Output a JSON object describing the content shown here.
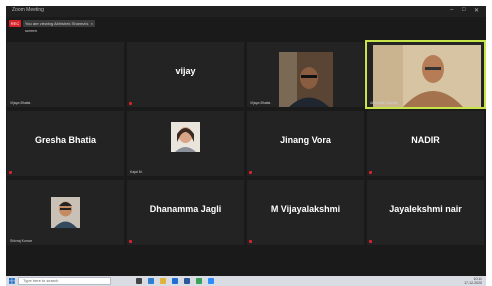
{
  "window": {
    "title": "Zoom Meeting",
    "controls": [
      "–",
      "□",
      "✕"
    ]
  },
  "toolbar": {
    "rec_label": "REC",
    "tab_label": "You are viewing Abhishek Sharma's screen"
  },
  "participants": [
    {
      "name": "",
      "caption": "Vijaya Bhatia"
    },
    {
      "name": "vijay",
      "caption": ""
    },
    {
      "name": "",
      "caption": "Vijaya Bhatia"
    },
    {
      "name": "",
      "caption": "Abhishek Sharma"
    },
    {
      "name": "Gresha Bhatia",
      "caption": ""
    },
    {
      "name": "",
      "caption": "Kajal M."
    },
    {
      "name": "Jinang Vora",
      "caption": ""
    },
    {
      "name": "NADIR",
      "caption": ""
    },
    {
      "name": "",
      "caption": "Shivraj Kumar"
    },
    {
      "name": "Dhanamma Jagli",
      "caption": ""
    },
    {
      "name": "M Vijayalakshmi",
      "caption": ""
    },
    {
      "name": "Jayalekshmi nair",
      "caption": ""
    }
  ],
  "taskbar": {
    "search_placeholder": "Type here to search",
    "tray_time": "10:11",
    "tray_date": "17-12-2020"
  }
}
